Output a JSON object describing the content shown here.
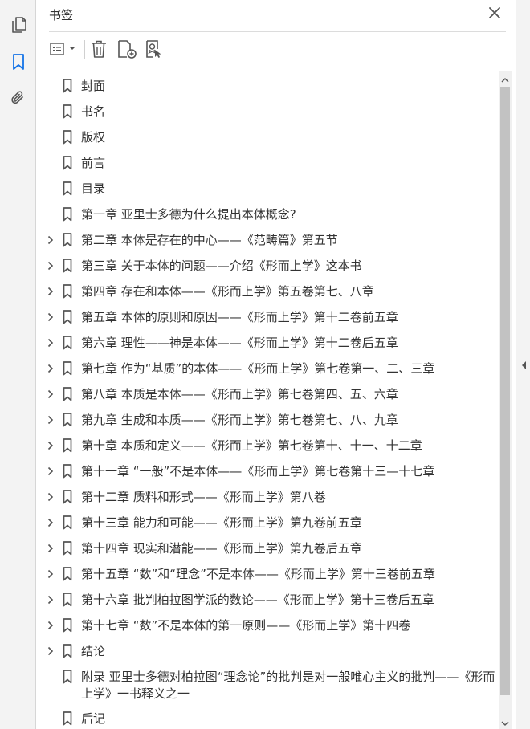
{
  "panel": {
    "title": "书签"
  },
  "colors": {
    "accent": "#1473e6",
    "icon_gray": "#555555",
    "scroll_thumb": "#c2c2c2"
  },
  "left_rail": {
    "items": [
      {
        "icon": "pages-icon",
        "selected": false
      },
      {
        "icon": "bookmark-panel-icon",
        "selected": true
      },
      {
        "icon": "attachment-icon",
        "selected": false
      }
    ]
  },
  "toolbar": {
    "items": [
      {
        "icon": "options-menu-icon"
      },
      {
        "icon": "delete-icon"
      },
      {
        "icon": "new-bookmark-icon"
      },
      {
        "icon": "bookmark-from-selection-icon"
      }
    ]
  },
  "bookmarks": [
    {
      "label": "封面",
      "expandable": false
    },
    {
      "label": "书名",
      "expandable": false
    },
    {
      "label": "版权",
      "expandable": false
    },
    {
      "label": "前言",
      "expandable": false
    },
    {
      "label": "目录",
      "expandable": false
    },
    {
      "label": "第一章  亚里士多德为什么提出本体概念?",
      "expandable": false
    },
    {
      "label": "第二章  本体是存在的中心——《范畴篇》第五节",
      "expandable": true
    },
    {
      "label": "第三章  关于本体的问题——介绍《形而上学》这本书",
      "expandable": true
    },
    {
      "label": "第四章  存在和本体——《形而上学》第五卷第七、八章",
      "expandable": true
    },
    {
      "label": "第五章  本体的原则和原因——《形而上学》第十二卷前五章",
      "expandable": true
    },
    {
      "label": "第六章  理性——神是本体——《形而上学》第十二卷后五章",
      "expandable": true
    },
    {
      "label": "第七章  作为“基质”的本体——《形而上学》第七卷第一、二、三章",
      "expandable": true
    },
    {
      "label": "第八章  本质是本体——《形而上学》第七卷第四、五、六章",
      "expandable": true
    },
    {
      "label": "第九章  生成和本质——《形而上学》第七卷第七、八、九章",
      "expandable": true
    },
    {
      "label": "第十章  本质和定义——《形而上学》第七卷第十、十一、十二章",
      "expandable": true
    },
    {
      "label": "第十一章  “一般”不是本体——《形而上学》第七卷第十三—十七章",
      "expandable": true
    },
    {
      "label": "第十二章  质料和形式——《形而上学》第八卷",
      "expandable": true
    },
    {
      "label": "第十三章  能力和可能——《形而上学》第九卷前五章",
      "expandable": true
    },
    {
      "label": "第十四章  现实和潜能——《形而上学》第九卷后五章",
      "expandable": true
    },
    {
      "label": "第十五章  “数”和“理念”不是本体——《形而上学》第十三卷前五章",
      "expandable": true
    },
    {
      "label": "第十六章  批判柏拉图学派的数论——《形而上学》第十三卷后五章",
      "expandable": true
    },
    {
      "label": "第十七章  “数”不是本体的第一原则——《形而上学》第十四卷",
      "expandable": true
    },
    {
      "label": "结论",
      "expandable": true
    },
    {
      "label": "附录  亚里士多德对柏拉图“理念论”的批判是对一般唯心主义的批判——《形而上学》一书释义之一",
      "expandable": false,
      "wrap": true
    },
    {
      "label": "后记",
      "expandable": false
    }
  ]
}
